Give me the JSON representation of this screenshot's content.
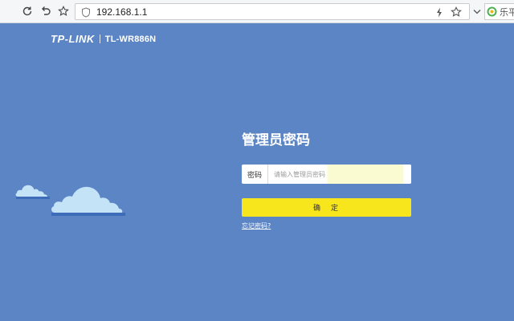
{
  "browser": {
    "address": "192.168.1.1",
    "search_text": "乐平",
    "icons": [
      "refresh-icon",
      "undo-icon",
      "star-icon",
      "shield-icon",
      "bolt-icon",
      "bookmark-star-icon",
      "chevron-down-icon",
      "search-engine-logo-icon"
    ]
  },
  "header": {
    "brand": "TP-LINK",
    "model": "TL-WR886N"
  },
  "login": {
    "title": "管理员密码",
    "password_label": "密码",
    "password_placeholder": "请输入管理员密码",
    "password_value": "",
    "confirm_label": "确　定",
    "forgot_link": "忘记密码?"
  },
  "colors": {
    "background": "#5b85c5",
    "confirm_button": "#f7e61b",
    "cloud_light": "#c5e3f7",
    "cloud_shadow": "#3d6cb8"
  }
}
